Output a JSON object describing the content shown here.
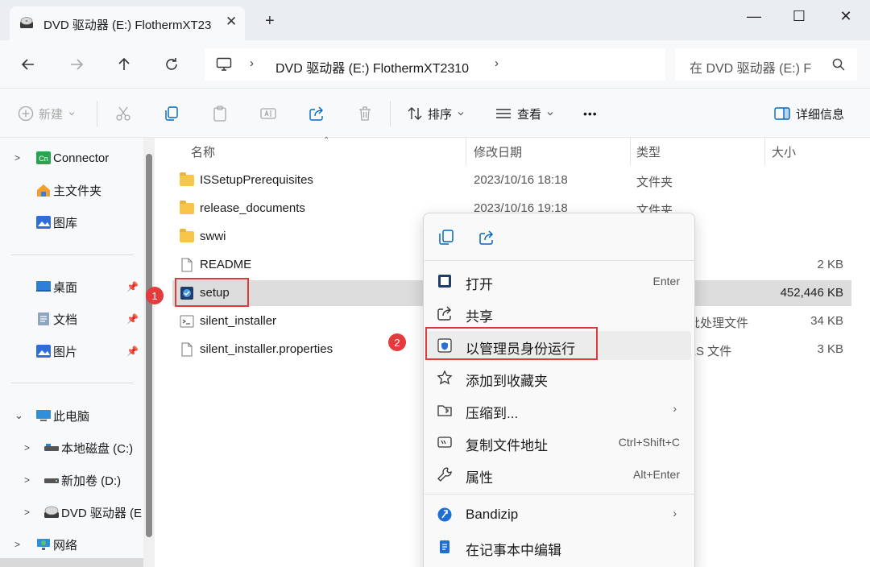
{
  "window": {
    "tab_title": "DVD 驱动器 (E:) FlothermXT23",
    "tab_close": "✕",
    "new_tab": "+",
    "minimize": "—",
    "maximize": "☐",
    "close": "✕"
  },
  "address": {
    "path_chevron": "›",
    "path": "DVD 驱动器 (E:) FlothermXT2310",
    "search_placeholder": "在 DVD 驱动器 (E:) F"
  },
  "toolbar": {
    "new_label": "新建",
    "sort_label": "排序",
    "view_label": "查看",
    "more_label": "•••",
    "details_label": "详细信息"
  },
  "sidebar": {
    "items": [
      {
        "label": "Connector",
        "icon": "connector-icon"
      },
      {
        "label": "主文件夹",
        "icon": "home-icon"
      },
      {
        "label": "图库",
        "icon": "gallery-icon"
      },
      {
        "label": "桌面",
        "icon": "desktop-icon",
        "pinned": true
      },
      {
        "label": "文档",
        "icon": "documents-icon",
        "pinned": true
      },
      {
        "label": "图片",
        "icon": "pictures-icon",
        "pinned": true
      },
      {
        "label": "此电脑",
        "icon": "this-pc-icon"
      },
      {
        "label": "本地磁盘 (C:)",
        "icon": "drive-icon"
      },
      {
        "label": "新加卷 (D:)",
        "icon": "drive-icon"
      },
      {
        "label": "DVD 驱动器 (E",
        "icon": "dvd-drive-icon"
      },
      {
        "label": "网络",
        "icon": "network-icon"
      }
    ]
  },
  "columns": {
    "name": "名称",
    "modified": "修改日期",
    "type": "类型",
    "size": "大小"
  },
  "files": [
    {
      "name": "ISSetupPrerequisites",
      "modified": "2023/10/16 18:18",
      "type": "文件夹",
      "size": ""
    },
    {
      "name": "release_documents",
      "modified": "2023/10/16 19:18",
      "type": "文件夹",
      "size": ""
    },
    {
      "name": "swwi",
      "modified": "",
      "type": "",
      "size": ""
    },
    {
      "name": "README",
      "modified": "",
      "type": "",
      "size": "2 KB"
    },
    {
      "name": "setup",
      "modified": "",
      "type": "",
      "size": "452,446 KB"
    },
    {
      "name": "silent_installer",
      "modified": "",
      "type": "批处理文件",
      "size": "34 KB"
    },
    {
      "name": "silent_installer.properties",
      "modified": "",
      "type": "ES 文件",
      "size": "3 KB"
    }
  ],
  "annotations": {
    "badge1": "1",
    "badge2": "2"
  },
  "context_menu": {
    "items": [
      {
        "label": "打开",
        "shortcut": "Enter",
        "icon": "open-icon"
      },
      {
        "label": "共享",
        "shortcut": "",
        "icon": "share-icon"
      },
      {
        "label": "以管理员身份运行",
        "shortcut": "",
        "icon": "shield-icon"
      },
      {
        "label": "添加到收藏夹",
        "shortcut": "",
        "icon": "star-icon"
      },
      {
        "label": "压缩到...",
        "shortcut": "",
        "icon": "zip-icon"
      },
      {
        "label": "复制文件地址",
        "shortcut": "Ctrl+Shift+C",
        "icon": "copy-path-icon"
      },
      {
        "label": "属性",
        "shortcut": "Alt+Enter",
        "icon": "wrench-icon"
      },
      {
        "label": "Bandizip",
        "shortcut": "",
        "icon": "bandizip-icon"
      },
      {
        "label": "在记事本中编辑",
        "shortcut": "",
        "icon": "notepad-icon"
      }
    ],
    "submenu_arrow": "›"
  },
  "colors": {
    "accent": "#0067c0",
    "annotation_red": "#e03a3a",
    "folder": "#f7c548"
  }
}
